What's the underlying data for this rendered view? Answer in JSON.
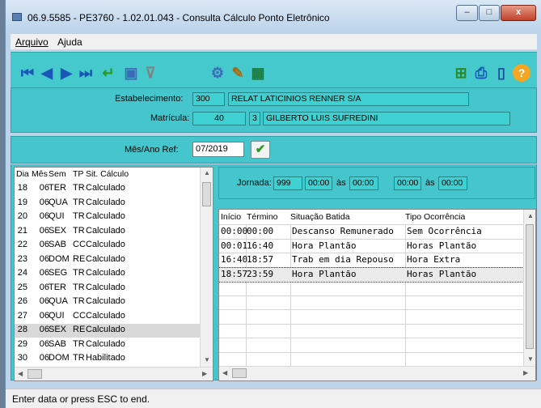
{
  "window": {
    "title": "06.9.5585 - PE3760 - 1.02.01.043 - Consulta Cálculo Ponto Eletrônico",
    "minimize": "–",
    "maximize": "□",
    "close": "x"
  },
  "menu": {
    "items": [
      "Arquivo",
      "Ajuda"
    ]
  },
  "toolbar": {
    "first": "⏮",
    "prev": "◀",
    "next": "▶",
    "last": "⏭",
    "return": "↵",
    "preview": "▣",
    "filter": "⊽",
    "settings": "⚙",
    "calc": "✎",
    "export": "▦",
    "tree": "⊞",
    "print": "⎙",
    "exit": "▯",
    "help": "?"
  },
  "header": {
    "estabelecimento_label": "Estabelecimento:",
    "estabelecimento_code": "300",
    "estabelecimento_name": "RELAT LATICINIOS RENNER S/A",
    "matricula_label": "Matrícula:",
    "matricula_num": "40",
    "matricula_digit": "3",
    "matricula_name": "GILBERTO LUIS SUFREDINI"
  },
  "ref": {
    "label": "Mês/Ano Ref:",
    "value": "07/2019",
    "ok": "✔"
  },
  "days": {
    "headers": [
      "Dia",
      "Mês",
      "Sem",
      "TP",
      "Sit. Cálculo"
    ],
    "rows": [
      [
        "18",
        "06",
        "TER",
        "TR",
        "Calculado"
      ],
      [
        "19",
        "06",
        "QUA",
        "TR",
        "Calculado"
      ],
      [
        "20",
        "06",
        "QUI",
        "TR",
        "Calculado"
      ],
      [
        "21",
        "06",
        "SEX",
        "TR",
        "Calculado"
      ],
      [
        "22",
        "06",
        "SAB",
        "CC",
        "Calculado"
      ],
      [
        "23",
        "06",
        "DOM",
        "RE",
        "Calculado"
      ],
      [
        "24",
        "06",
        "SEG",
        "TR",
        "Calculado"
      ],
      [
        "25",
        "06",
        "TER",
        "TR",
        "Calculado"
      ],
      [
        "26",
        "06",
        "QUA",
        "TR",
        "Calculado"
      ],
      [
        "27",
        "06",
        "QUI",
        "CC",
        "Calculado"
      ],
      [
        "28",
        "06",
        "SEX",
        "RE",
        "Calculado"
      ],
      [
        "29",
        "06",
        "SAB",
        "TR",
        "Calculado"
      ],
      [
        "30",
        "06",
        "DOM",
        "TR",
        "Habilitado"
      ]
    ]
  },
  "jornada": {
    "label": "Jornada:",
    "code": "999",
    "t1": "00:00",
    "as1": "às",
    "t2": "00:00",
    "t3": "00:00",
    "as2": "às",
    "t4": "00:00"
  },
  "batidas": {
    "headers": [
      "Início",
      "Término",
      "Situação Batida",
      "Tipo Ocorrência"
    ],
    "rows": [
      [
        "00:00",
        "00:00",
        "Descanso Remunerado",
        "Sem Ocorrência"
      ],
      [
        "00:01",
        "16:40",
        "Hora Plantão",
        "Horas Plantão"
      ],
      [
        "16:40",
        "18:57",
        "Trab em dia Repouso",
        "Hora Extra"
      ],
      [
        "18:57",
        "23:59",
        "Hora Plantão",
        "Horas Plantão"
      ]
    ]
  },
  "status": {
    "text": "Enter data or press ESC to end."
  }
}
